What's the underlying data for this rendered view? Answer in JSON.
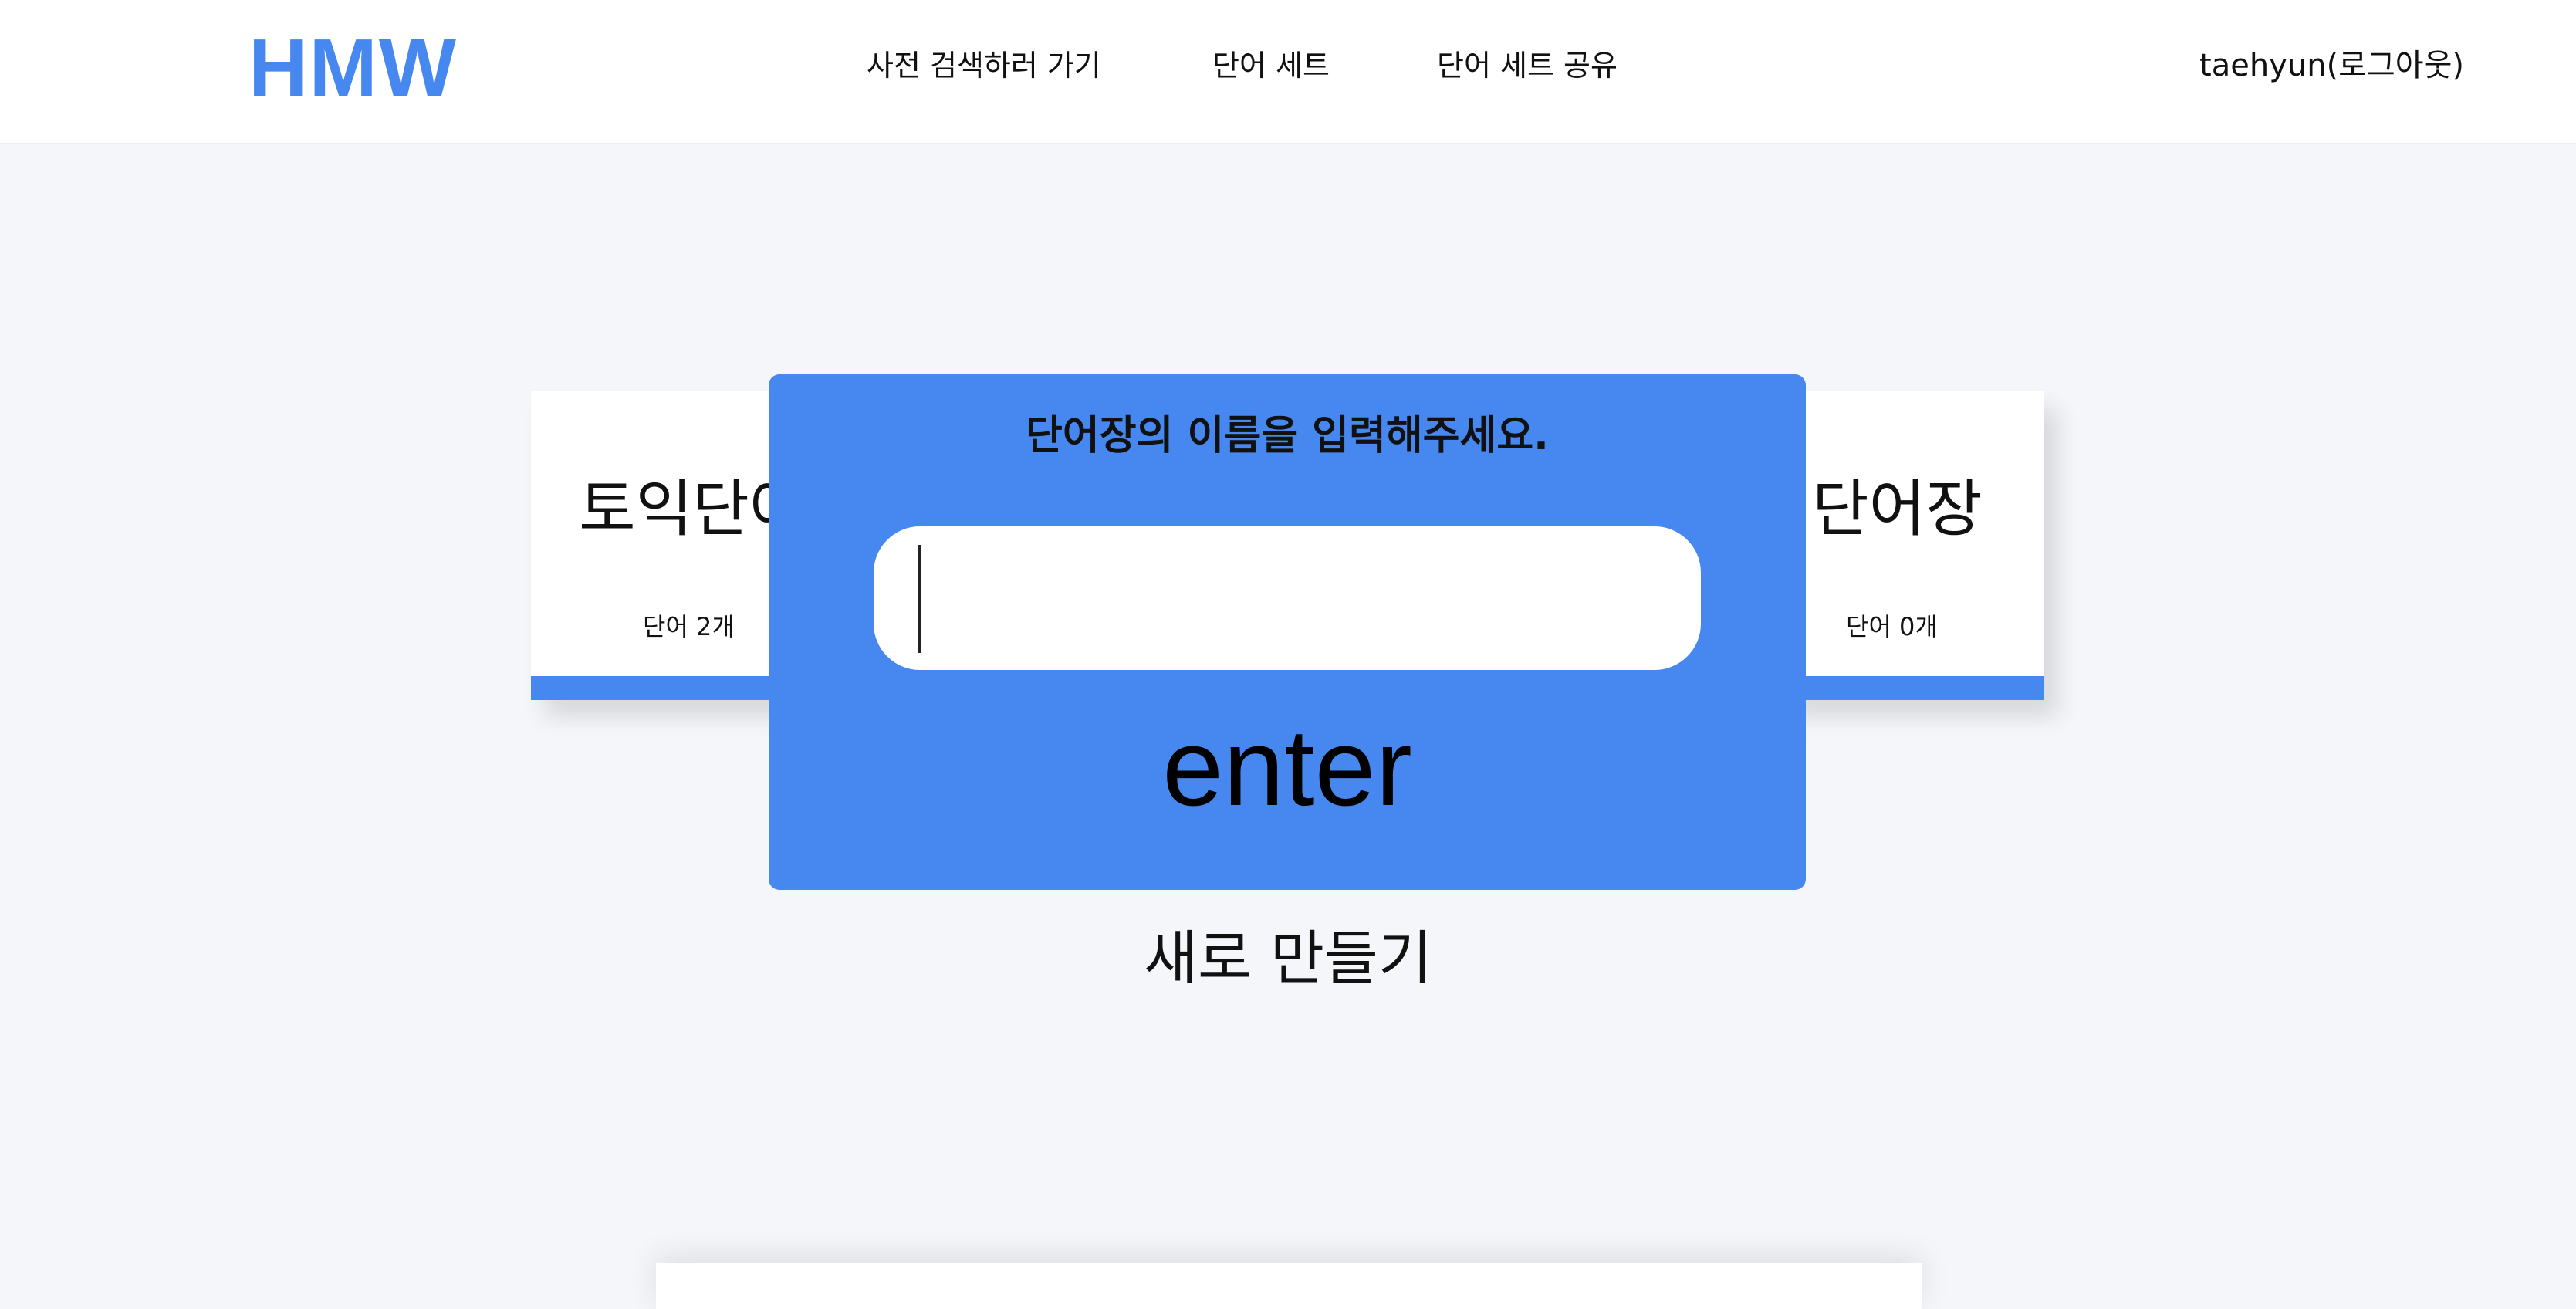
{
  "header": {
    "logo": "HMW",
    "nav": {
      "dictionary_search": "사전 검색하러 가기",
      "word_sets": "단어 세트",
      "share_word_sets": "단어 세트 공유"
    },
    "user_logout": "taehyun(로그아웃)"
  },
  "cards": [
    {
      "title": "토익단어장",
      "count": "단어 2개"
    },
    {
      "title": "단어장",
      "count": "단어 0개"
    }
  ],
  "modal": {
    "title": "단어장의 이름을 입력해주세요.",
    "input_value": "",
    "enter_label": "enter"
  },
  "create_new_label": "새로 만들기",
  "colors": {
    "accent": "#4688ef",
    "background": "#f4f6fa"
  }
}
